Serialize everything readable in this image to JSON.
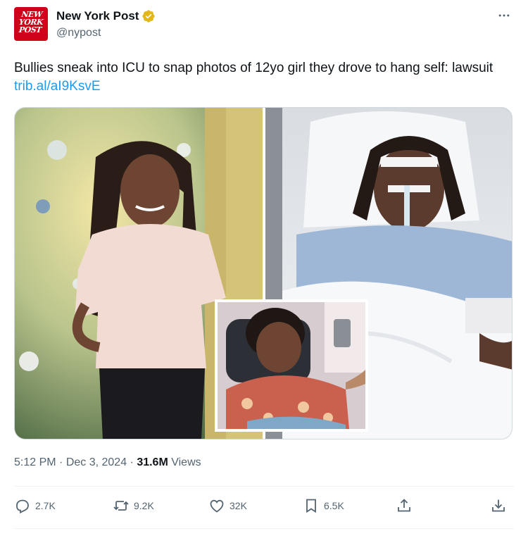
{
  "account": {
    "name": "New York Post",
    "handle": "@nypost",
    "logo_text": "NEW YORK POST",
    "logo_color": "#d0021b",
    "verified_badge_color": "#e2b719"
  },
  "tweet": {
    "text": "Bullies sneak into ICU to snap photos of 12yo girl they drove to hang self: lawsuit ",
    "link": "trib.al/aI9KsvE",
    "link_color": "#1d9bf0"
  },
  "media": {
    "panels": [
      "girl-in-sweater-photo",
      "girl-in-hospital-bed-photo",
      "girl-in-wheelchair-inset-photo"
    ]
  },
  "meta": {
    "time": "5:12 PM",
    "sep1": " · ",
    "date": "Dec 3, 2024",
    "sep2": " · ",
    "views_count": "31.6M",
    "views_label": " Views"
  },
  "actions": {
    "replies": "2.7K",
    "reposts": "9.2K",
    "likes": "32K",
    "bookmarks": "6.5K"
  },
  "icons": [
    "more-icon",
    "reply-icon",
    "repost-icon",
    "like-icon",
    "bookmark-icon",
    "share-icon",
    "download-icon",
    "verified-icon"
  ]
}
